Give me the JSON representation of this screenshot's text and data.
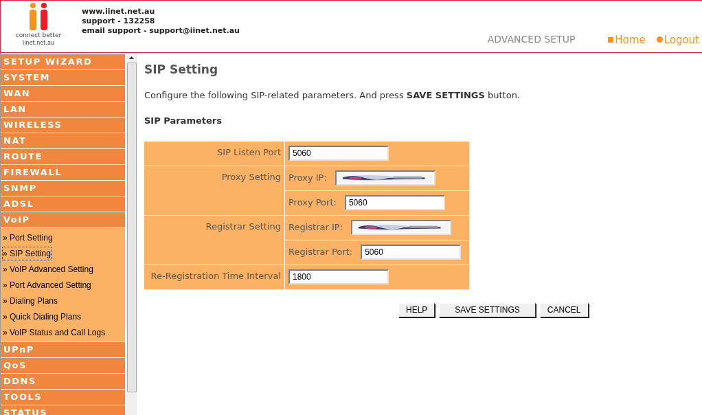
{
  "header": {
    "logo_caption": "connect better",
    "logo_url": "iinet.net.au",
    "contact": [
      "www.iinet.net.au",
      "support - 132258",
      "email support - support@iinet.net.au"
    ],
    "section_title": "ADVANCED SETUP",
    "links": [
      {
        "label": "Home",
        "kind": "square"
      },
      {
        "label": "Logout",
        "kind": "circle"
      }
    ]
  },
  "sidebar": {
    "items": [
      {
        "label": "SETUP WIZARD"
      },
      {
        "label": "SYSTEM"
      },
      {
        "label": "WAN"
      },
      {
        "label": "LAN"
      },
      {
        "label": "WIRELESS"
      },
      {
        "label": "NAT"
      },
      {
        "label": "ROUTE"
      },
      {
        "label": "FIREWALL"
      },
      {
        "label": "SNMP"
      },
      {
        "label": "ADSL"
      },
      {
        "label": "VoIP",
        "children": [
          {
            "label": "» Port Setting",
            "selected": false
          },
          {
            "label": "» SIP Setting",
            "selected": true
          },
          {
            "label": "» VoIP Advanced Setting",
            "selected": false
          },
          {
            "label": "» Port Advanced Setting",
            "selected": false
          },
          {
            "label": "» Dialing Plans",
            "selected": false
          },
          {
            "label": "» Quick Dialing Plans",
            "selected": false
          },
          {
            "label": "» VoIP Status and Call Logs",
            "selected": false
          }
        ]
      },
      {
        "label": "UPnP"
      },
      {
        "label": "QoS"
      },
      {
        "label": "DDNS"
      },
      {
        "label": "TOOLS"
      },
      {
        "label": "STATUS"
      }
    ]
  },
  "page": {
    "title": "SIP Setting",
    "intro": "Configure the following SIP-related parameters. And press **SAVE SETTINGS** button.",
    "subtitle": "SIP Parameters",
    "rows": [
      {
        "label": "SIP Listen Port",
        "fields": [
          {
            "value": "5060"
          }
        ]
      },
      {
        "label": "Proxy Setting",
        "fields": [
          {
            "label": "Proxy IP:",
            "kind": "picture"
          },
          {
            "label": "Proxy Port:",
            "value": "5060"
          }
        ]
      },
      {
        "label": "Registrar Setting",
        "fields": [
          {
            "label": "Registrar IP:",
            "kind": "picture"
          },
          {
            "label": "Registrar Port:",
            "value": "5060"
          }
        ]
      },
      {
        "label": "Re-Registration Time Interval",
        "fields": [
          {
            "value": "1800"
          }
        ]
      }
    ],
    "buttons": [
      "HELP",
      "SAVE SETTINGS",
      "CANCEL"
    ]
  }
}
